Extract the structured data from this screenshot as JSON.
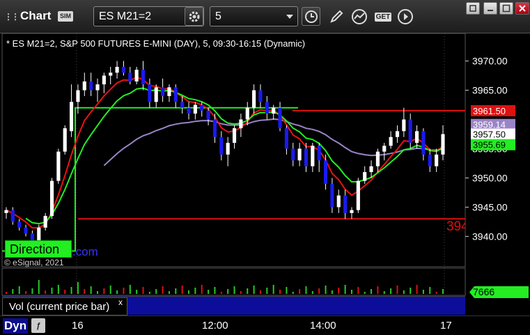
{
  "toolbar": {
    "title": "Chart",
    "sim_badge": "SIM",
    "symbol": "ES M21=2",
    "interval": "5",
    "get_label": "GET"
  },
  "chart": {
    "header": "* ES M21=2, S&P 500 FUTURES E-MINI (DAY), 5, 09:30-16:15 (Dynamic)",
    "direction_label": "Direction",
    "link_text": ".com",
    "copyright": "© eSignal, 2021"
  },
  "price_axis": {
    "ticks": [
      "3970.00",
      "3965.00",
      "3950.00",
      "3945.00",
      "3940.00"
    ],
    "boxes": [
      {
        "label": "3961.50",
        "bg": "#e01010",
        "fg": "#ffffff"
      },
      {
        "label": "3959.14",
        "bg": "#9a84c8",
        "fg": "#ffffff"
      },
      {
        "label": "3957.50",
        "bg": "#ffffff",
        "fg": "#000000"
      },
      {
        "label": "3955.69",
        "bg": "#22ee22",
        "fg": "#000000"
      }
    ],
    "partial_tick": "3955.00",
    "level_label": "394"
  },
  "volume": {
    "label": "Vol (current price bar)",
    "value": "7666",
    "close": "x"
  },
  "bottom": {
    "dyn": "Dyn",
    "times": [
      "16",
      "12:00",
      "14:00",
      "17"
    ]
  },
  "chart_data": {
    "type": "candlestick",
    "ylim": [
      3936,
      3974
    ],
    "levels": [
      {
        "value": 3961.5,
        "color": "#e01010"
      },
      {
        "value": 3943.0,
        "color": "#e01010"
      }
    ],
    "colors": {
      "up": "#ffffff",
      "down": "#1a1aee",
      "ma_red": "#ee1111",
      "ma_purple": "#9a84c8",
      "ma_green": "#22ee22",
      "step": "#22ee22"
    },
    "candles": [
      [
        3944,
        3945,
        3943,
        3944.5
      ],
      [
        3944.5,
        3945,
        3942,
        3942.5
      ],
      [
        3942.5,
        3943,
        3941,
        3941.5
      ],
      [
        3941.5,
        3942,
        3940,
        3940.5
      ],
      [
        3940.5,
        3941,
        3938.5,
        3939
      ],
      [
        3939,
        3942,
        3938.5,
        3941.5
      ],
      [
        3941.5,
        3944,
        3941,
        3943.5
      ],
      [
        3943.5,
        3950,
        3943,
        3949.5
      ],
      [
        3949.5,
        3955,
        3949,
        3954.5
      ],
      [
        3954.5,
        3959,
        3954,
        3958.5
      ],
      [
        3958,
        3966,
        3957,
        3963
      ],
      [
        3963,
        3966,
        3961,
        3965
      ],
      [
        3965,
        3968,
        3964,
        3966.5
      ],
      [
        3966.5,
        3968,
        3964,
        3965
      ],
      [
        3965,
        3967,
        3963,
        3966
      ],
      [
        3966,
        3968,
        3964.5,
        3967.5
      ],
      [
        3967.5,
        3969,
        3966,
        3968
      ],
      [
        3968,
        3970,
        3967,
        3969
      ],
      [
        3969,
        3970,
        3967.5,
        3968
      ],
      [
        3968,
        3969,
        3966,
        3966.5
      ],
      [
        3966.5,
        3969,
        3966,
        3968.5
      ],
      [
        3968.5,
        3970,
        3965,
        3966
      ],
      [
        3966,
        3967,
        3962,
        3963
      ],
      [
        3963,
        3966,
        3962,
        3965.5
      ],
      [
        3965.5,
        3967,
        3963,
        3964
      ],
      [
        3964,
        3966,
        3963,
        3965.5
      ],
      [
        3965.5,
        3966,
        3962,
        3963
      ],
      [
        3963,
        3964,
        3961,
        3962
      ],
      [
        3962,
        3963,
        3960,
        3961
      ],
      [
        3961,
        3963,
        3960,
        3962.5
      ],
      [
        3962.5,
        3963,
        3960.5,
        3961.5
      ],
      [
        3961.5,
        3962,
        3959,
        3960
      ],
      [
        3960,
        3961,
        3956,
        3957
      ],
      [
        3957,
        3958,
        3953,
        3954
      ],
      [
        3954,
        3957,
        3952,
        3956
      ],
      [
        3956,
        3959,
        3955,
        3958.5
      ],
      [
        3958.5,
        3961,
        3957,
        3960
      ],
      [
        3960,
        3963,
        3959,
        3962
      ],
      [
        3962,
        3966,
        3961,
        3965
      ],
      [
        3965,
        3966,
        3962,
        3963
      ],
      [
        3963,
        3964,
        3960,
        3961
      ],
      [
        3961,
        3962.5,
        3960,
        3962
      ],
      [
        3962,
        3963,
        3958,
        3958.5
      ],
      [
        3958.5,
        3959,
        3954,
        3955
      ],
      [
        3955,
        3956,
        3952,
        3953
      ],
      [
        3953,
        3956,
        3952,
        3955
      ],
      [
        3955,
        3956,
        3951,
        3952
      ],
      [
        3952,
        3956,
        3951,
        3955.5
      ],
      [
        3955.5,
        3956,
        3951,
        3953
      ],
      [
        3953,
        3954,
        3948,
        3949
      ],
      [
        3949,
        3950,
        3944,
        3945
      ],
      [
        3945,
        3948,
        3944,
        3947
      ],
      [
        3947,
        3948,
        3943,
        3944
      ],
      [
        3944,
        3945,
        3943,
        3944.5
      ],
      [
        3944.5,
        3950,
        3944,
        3949.5
      ],
      [
        3949.5,
        3952,
        3949,
        3951
      ],
      [
        3951,
        3953,
        3950,
        3952
      ],
      [
        3952,
        3955,
        3951,
        3954.5
      ],
      [
        3954.5,
        3956,
        3953,
        3955.5
      ],
      [
        3955.5,
        3958,
        3955,
        3957
      ],
      [
        3957,
        3959,
        3956,
        3958
      ],
      [
        3958,
        3962,
        3957,
        3960
      ],
      [
        3960,
        3961,
        3955,
        3956
      ],
      [
        3956,
        3959,
        3955,
        3958
      ],
      [
        3958,
        3958.5,
        3953,
        3954
      ],
      [
        3954,
        3955,
        3951,
        3952
      ],
      [
        3952,
        3955,
        3951,
        3954
      ],
      [
        3954,
        3959,
        3953,
        3957.5
      ]
    ],
    "volume_value": 7666
  }
}
